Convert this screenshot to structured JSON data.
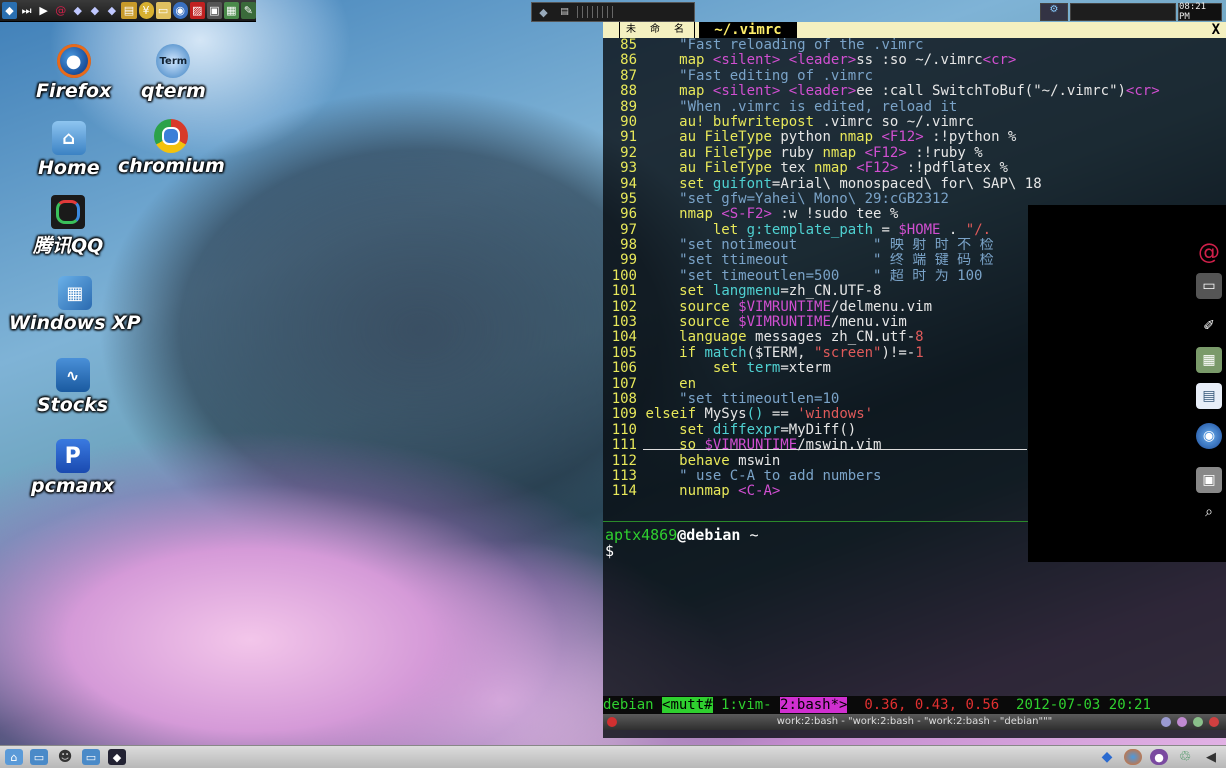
{
  "desktop_icons": [
    {
      "label": "Firefox",
      "icon": "firefox-icon"
    },
    {
      "label": "qterm",
      "icon": "qterm-icon"
    },
    {
      "label": "Home",
      "icon": "home-folder-icon"
    },
    {
      "label": "chromium",
      "icon": "chromium-icon"
    },
    {
      "label": "腾讯QQ",
      "icon": "qq-icon"
    },
    {
      "label": "Windows XP",
      "icon": "virtualbox-icon"
    },
    {
      "label": "Stocks",
      "icon": "stocks-icon"
    },
    {
      "label": "pcmanx",
      "icon": "pcmanx-icon"
    }
  ],
  "top_panel": {
    "clock": "08:21 PM"
  },
  "vim": {
    "tab_inactive": "未 命 名",
    "tab_active": "~/.vimrc",
    "tab_close": "X",
    "lines": [
      {
        "n": "85",
        "parts": [
          [
            "c-cmt",
            "    \"Fast reloading of the .vimrc"
          ]
        ]
      },
      {
        "n": "86",
        "parts": [
          [
            "",
            "    "
          ],
          [
            "c-kw",
            "map"
          ],
          [
            "",
            " "
          ],
          [
            "c-key",
            "<silent>"
          ],
          [
            "",
            " "
          ],
          [
            "c-key",
            "<leader>"
          ],
          [
            "",
            "ss :so ~/.vimrc"
          ],
          [
            "c-key",
            "<cr>"
          ]
        ]
      },
      {
        "n": "87",
        "parts": [
          [
            "c-cmt",
            "    \"Fast editing of .vimrc"
          ]
        ]
      },
      {
        "n": "88",
        "parts": [
          [
            "",
            "    "
          ],
          [
            "c-kw",
            "map"
          ],
          [
            "",
            " "
          ],
          [
            "c-key",
            "<silent>"
          ],
          [
            "",
            " "
          ],
          [
            "c-key",
            "<leader>"
          ],
          [
            "",
            "ee :call SwitchToBuf(\"~/.vimrc\")"
          ],
          [
            "c-key",
            "<cr>"
          ]
        ]
      },
      {
        "n": "89",
        "parts": [
          [
            "c-cmt",
            "    \"When .vimrc is edited, reload it"
          ]
        ]
      },
      {
        "n": "90",
        "parts": [
          [
            "",
            "    "
          ],
          [
            "c-kw",
            "au!"
          ],
          [
            "",
            " "
          ],
          [
            "c-kw",
            "bufwritepost"
          ],
          [
            "",
            " .vimrc so ~/.vimrc"
          ]
        ]
      },
      {
        "n": "91",
        "parts": [
          [
            "",
            "    "
          ],
          [
            "c-kw",
            "au"
          ],
          [
            "",
            " "
          ],
          [
            "c-kw",
            "FileType"
          ],
          [
            "",
            " python "
          ],
          [
            "c-kw",
            "nmap"
          ],
          [
            "",
            " "
          ],
          [
            "c-key",
            "<F12>"
          ],
          [
            "",
            " :!python %"
          ]
        ]
      },
      {
        "n": "92",
        "parts": [
          [
            "",
            "    "
          ],
          [
            "c-kw",
            "au"
          ],
          [
            "",
            " "
          ],
          [
            "c-kw",
            "FileType"
          ],
          [
            "",
            " ruby "
          ],
          [
            "c-kw",
            "nmap"
          ],
          [
            "",
            " "
          ],
          [
            "c-key",
            "<F12>"
          ],
          [
            "",
            " :!ruby %"
          ]
        ]
      },
      {
        "n": "93",
        "parts": [
          [
            "",
            "    "
          ],
          [
            "c-kw",
            "au"
          ],
          [
            "",
            " "
          ],
          [
            "c-kw",
            "FileType"
          ],
          [
            "",
            " tex "
          ],
          [
            "c-kw",
            "nmap"
          ],
          [
            "",
            " "
          ],
          [
            "c-key",
            "<F12>"
          ],
          [
            "",
            " :!pdflatex %"
          ]
        ]
      },
      {
        "n": "94",
        "parts": [
          [
            "",
            "    "
          ],
          [
            "c-kw",
            "set"
          ],
          [
            "",
            " "
          ],
          [
            "c-var",
            "guifont"
          ],
          [
            "",
            "=Arial\\ monospaced\\ for\\ SAP\\ 18"
          ]
        ]
      },
      {
        "n": "95",
        "parts": [
          [
            "c-cmt",
            "    \"set gfw=Yahei\\ Mono\\ 29:cGB2312"
          ]
        ]
      },
      {
        "n": "96",
        "parts": [
          [
            "",
            "    "
          ],
          [
            "c-kw",
            "nmap"
          ],
          [
            "",
            " "
          ],
          [
            "c-key",
            "<S-F2>"
          ],
          [
            "",
            " :w !sudo tee %"
          ]
        ]
      },
      {
        "n": "97",
        "parts": [
          [
            "",
            "        "
          ],
          [
            "c-kw",
            "let"
          ],
          [
            "",
            " "
          ],
          [
            "c-var",
            "g:template_path"
          ],
          [
            "",
            " = "
          ],
          [
            "c-key",
            "$HOME"
          ],
          [
            "",
            " . "
          ],
          [
            "c-str",
            "\"/."
          ]
        ]
      },
      {
        "n": "98",
        "parts": [
          [
            "c-cmt",
            "    \"set notimeout         \" 映 射 时 不 检"
          ]
        ]
      },
      {
        "n": "99",
        "parts": [
          [
            "c-cmt",
            "    \"set ttimeout          \" 终 端 键 码 检"
          ]
        ]
      },
      {
        "n": "100",
        "parts": [
          [
            "c-cmt",
            "    \"set timeoutlen=500    \" 超 时 为 100"
          ]
        ]
      },
      {
        "n": "101",
        "parts": [
          [
            "",
            "    "
          ],
          [
            "c-kw",
            "set"
          ],
          [
            "",
            " "
          ],
          [
            "c-var",
            "langmenu"
          ],
          [
            "",
            "=zh_CN.UTF-8"
          ]
        ]
      },
      {
        "n": "102",
        "parts": [
          [
            "",
            "    "
          ],
          [
            "c-kw",
            "source"
          ],
          [
            "",
            " "
          ],
          [
            "c-key",
            "$VIMRUNTIME"
          ],
          [
            "",
            "/delmenu.vim"
          ]
        ]
      },
      {
        "n": "103",
        "parts": [
          [
            "",
            "    "
          ],
          [
            "c-kw",
            "source"
          ],
          [
            "",
            " "
          ],
          [
            "c-key",
            "$VIMRUNTIME"
          ],
          [
            "",
            "/menu.vim"
          ]
        ]
      },
      {
        "n": "104",
        "parts": [
          [
            "",
            "    "
          ],
          [
            "c-kw",
            "language"
          ],
          [
            "",
            " messages zh_CN.utf-"
          ],
          [
            "c-str",
            "8"
          ]
        ]
      },
      {
        "n": "105",
        "parts": [
          [
            "",
            "    "
          ],
          [
            "c-kw",
            "if"
          ],
          [
            "",
            " "
          ],
          [
            "c-fn",
            "match"
          ],
          [
            "",
            "($TERM, "
          ],
          [
            "c-str",
            "\"screen\""
          ],
          [
            "",
            ")!=-"
          ],
          [
            "c-str",
            "1"
          ]
        ]
      },
      {
        "n": "106",
        "parts": [
          [
            "",
            "        "
          ],
          [
            "c-kw",
            "set"
          ],
          [
            "",
            " "
          ],
          [
            "c-var",
            "term"
          ],
          [
            "",
            "=xterm"
          ]
        ]
      },
      {
        "n": "107",
        "parts": [
          [
            "",
            "    "
          ],
          [
            "c-kw",
            "en"
          ]
        ]
      },
      {
        "n": "108",
        "parts": [
          [
            "c-cmt",
            "    \"set ttimeoutlen=10"
          ]
        ]
      },
      {
        "n": "109",
        "parts": [
          [
            "c-kw",
            "elseif"
          ],
          [
            "",
            " "
          ],
          [
            "",
            "MySys"
          ],
          [
            "c-fn",
            "()"
          ],
          [
            "",
            " == "
          ],
          [
            "c-str",
            "'windows'"
          ]
        ]
      },
      {
        "n": "110",
        "parts": [
          [
            "",
            "    "
          ],
          [
            "c-kw",
            "set"
          ],
          [
            "",
            " "
          ],
          [
            "c-var",
            "diffexpr"
          ],
          [
            "",
            "=MyDiff()"
          ]
        ]
      },
      {
        "n": "111",
        "parts": [
          [
            "",
            "    "
          ],
          [
            "c-kw",
            "so"
          ],
          [
            "",
            " "
          ],
          [
            "c-key",
            "$VIMRUNTIME"
          ],
          [
            "",
            "/mswin.vim"
          ]
        ]
      },
      {
        "n": "112",
        "parts": [
          [
            "",
            "    "
          ],
          [
            "c-kw",
            "behave"
          ],
          [
            "",
            " mswin"
          ]
        ]
      },
      {
        "n": "113",
        "parts": [
          [
            "c-cmt",
            "    \" use C-A to add numbers"
          ]
        ]
      },
      {
        "n": "114",
        "parts": [
          [
            "",
            "    "
          ],
          [
            "c-kw",
            "nunmap"
          ],
          [
            "",
            " "
          ],
          [
            "c-key",
            "<C-A>"
          ]
        ]
      }
    ]
  },
  "shell": {
    "user": "aptx4869",
    "at": "@",
    "host": "debian",
    "cwd": " ~",
    "prompt": "$"
  },
  "screen_status": {
    "host": "debian",
    "tab_mutt": "<mutt#",
    "tab_vim": " 1:vim- ",
    "tab_bash": "2:bash*>",
    "load": "0.36, 0.43, 0.56",
    "datetime": "2012-07-03 20:21"
  },
  "window_title": "work:2:bash - \"work:2:bash - \"work:2:bash - \"debian\"\"\"",
  "colors": {
    "vim_tabline_bg": "#f4f0c0",
    "line_number": "#e8e85a",
    "comment": "#7aa3c8",
    "keyword": "#e8e85a",
    "special": "#d14fd1",
    "string": "#e05a5a",
    "prompt_user": "#2fd02f"
  }
}
